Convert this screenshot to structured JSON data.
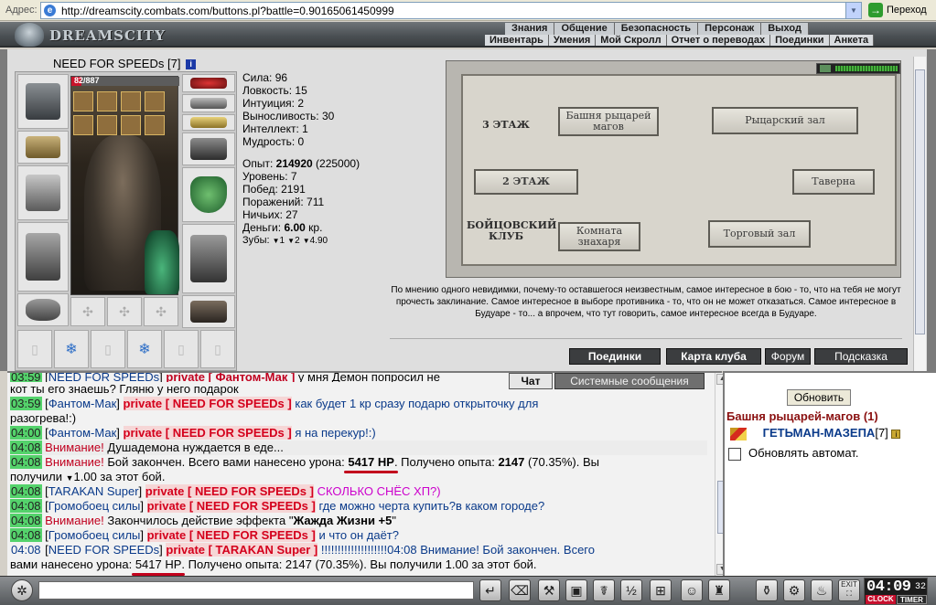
{
  "browser": {
    "address_label": "Адрес:",
    "url": "http://dreamscity.combats.com/buttons.pl?battle=0.90165061450999",
    "go_label": "Переход"
  },
  "header": {
    "logo": "DREAMSCITY",
    "main_nav": [
      "Знания",
      "Общение",
      "Безопасность",
      "Персонаж",
      "Выход"
    ],
    "sub_nav": [
      "Инвентарь",
      "Умения",
      "Мой Скролл",
      "Отчет о переводах",
      "Поединки",
      "Анкета"
    ]
  },
  "character": {
    "name": "NEED FOR SPEEDs",
    "level": "[7]",
    "info_icon": "i",
    "hp_text": "82/887",
    "hp_fraction": 0.092
  },
  "stats": {
    "strength": "Сила: 96",
    "agility": "Ловкость: 15",
    "intuition": "Интуиция: 2",
    "endurance": "Выносливость: 30",
    "intellect": "Интеллект: 1",
    "wisdom": "Мудрость: 0",
    "exp_label": "Опыт:",
    "exp_value": "214920",
    "exp_next": "(225000)",
    "level_line": "Уровень: 7",
    "wins": "Побед: 2191",
    "losses": "Поражений: 711",
    "draws": "Ничьих: 27",
    "money_label": "Деньги:",
    "money_value": "6.00",
    "money_unit": "кр.",
    "teeth_label": "Зубы:",
    "teeth_values": [
      "1",
      "2",
      "4.90"
    ]
  },
  "map": {
    "floor3": "3 ЭТАЖ",
    "floor2": "2 ЭТАЖ",
    "club": "БОЙЦОВСКИЙ КЛУБ",
    "tower": "Башня рыцарей магов",
    "knights_hall": "Рыцарский зал",
    "tavern": "Таверна",
    "healer_room": "Комната знахаря",
    "trade_hall": "Торговый зал"
  },
  "quote": "По мнению одного невидимки, почему-то оставшегося неизвестным, самое интересное в бою - то, что на тебя не могут прочесть заклинание. Самое интересное в выборе противника - то, что он не может отказаться. Самое интересное в Будуаре - то... а впрочем, что тут говорить, самое интересное всегда в Будуаре.",
  "bottom_buttons": [
    "Поединки",
    "Карта клуба",
    "Форум",
    "Подсказка"
  ],
  "chat_tabs": [
    "Чат",
    "Системные сообщения"
  ],
  "chat": {
    "l0_time": "03:59",
    "l0_name": "NEED FOR SPEEDs",
    "l0_priv": "private [ Фантом-Мак ]",
    "l0_msg": " у мня Демон попросил не",
    "l1": "кот ты его знаешь? Гляню у него подарок",
    "l2_time": "03:59",
    "l2_name": "Фантом-Мак",
    "l2_priv": "private [ NEED FOR SPEEDs ]",
    "l2_msg": " как будет 1 кр сразу подарю открыточку для",
    "l3": "разогрева!:)",
    "l4_time": "04:00",
    "l4_name": "Фантом-Мак",
    "l4_priv": "private [ NEED FOR SPEEDs ]",
    "l4_msg": " я на перекур!:)",
    "l5_time": "04:08",
    "l5_warn": "Внимание!",
    "l5_msg": " Душадемона нуждается в еде...",
    "l6_time": "04:08",
    "l6_warn": "Внимание!",
    "l6_msg_a": " Бой закончен. Всего вами нанесено урона: ",
    "l6_hp": "5417 HP",
    "l6_msg_b": ". Получено опыта: ",
    "l6_exp": "2147",
    "l6_msg_c": " (70.35%). Вы",
    "l7_a": "получили ",
    "l7_b": "1.00 за этот бой.",
    "l8_time": "04:08",
    "l8_name": "TARAKAN Super",
    "l8_priv": "private [ NEED FOR SPEEDs ]",
    "l8_msg": " СКОЛЬКО СНЁС ХП?)",
    "l9_time": "04:08",
    "l9_name": "Громобоец силы",
    "l9_priv": "private [ NEED FOR SPEEDs ]",
    "l9_msg": " где можно черта купить?в каком городе?",
    "l10_time": "04:08",
    "l10_warn": "Внимание!",
    "l10_msg_a": " Закончилось действие эффекта \"",
    "l10_eff": "Жажда Жизни +5",
    "l10_msg_b": "\"",
    "l11_time": "04:08",
    "l11_name": "Громобоец силы",
    "l11_priv": "private [ NEED FOR SPEEDs ]",
    "l11_msg": " и что он даёт?",
    "l12_time": "04:08",
    "l12_name": "NEED FOR SPEEDs",
    "l12_priv": "private [ TARAKAN Super ]",
    "l12_msg": " !!!!!!!!!!!!!!!!!!!!04:08 Внимание! Бой закончен. Всего",
    "l13_a": "вами нанесено урона: ",
    "l13_hp": "5417 HP",
    "l13_b": ". Получено опыта: 2147 (70.35%). Вы получили 1.00 за этот бой."
  },
  "room": {
    "refresh": "Обновить",
    "title": "Башня рыцарей-магов (1)",
    "user_name": "ГЕТЬМАН-МАЗЕПА",
    "user_level": "[7]",
    "info_icon": "i",
    "auto_refresh": "Обновлять автомат."
  },
  "toolbar": {
    "time": "04:09",
    "seconds": "32",
    "clock_btn": "CLOCK",
    "timer_btn": "TIMER",
    "exit_label": "EXIT"
  }
}
